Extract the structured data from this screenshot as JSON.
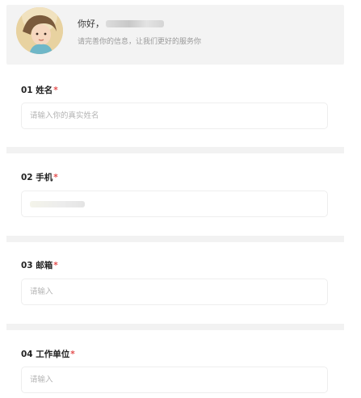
{
  "header": {
    "greeting": "你好，",
    "subtitle": "请完善你的信息，让我们更好的服务你"
  },
  "fields": [
    {
      "number": "01",
      "label": "姓名",
      "required_mark": "*",
      "placeholder": "请输入你的真实姓名",
      "value": ""
    },
    {
      "number": "02",
      "label": "手机",
      "required_mark": "*",
      "placeholder": "",
      "value": ""
    },
    {
      "number": "03",
      "label": "邮箱",
      "required_mark": "*",
      "placeholder": "请输入",
      "value": ""
    },
    {
      "number": "04",
      "label": "工作单位",
      "required_mark": "*",
      "placeholder": "请输入",
      "value": ""
    }
  ],
  "colors": {
    "required": "#e34d4d",
    "divider": "#f2f2f2",
    "header_bg": "#f3f3f3"
  }
}
